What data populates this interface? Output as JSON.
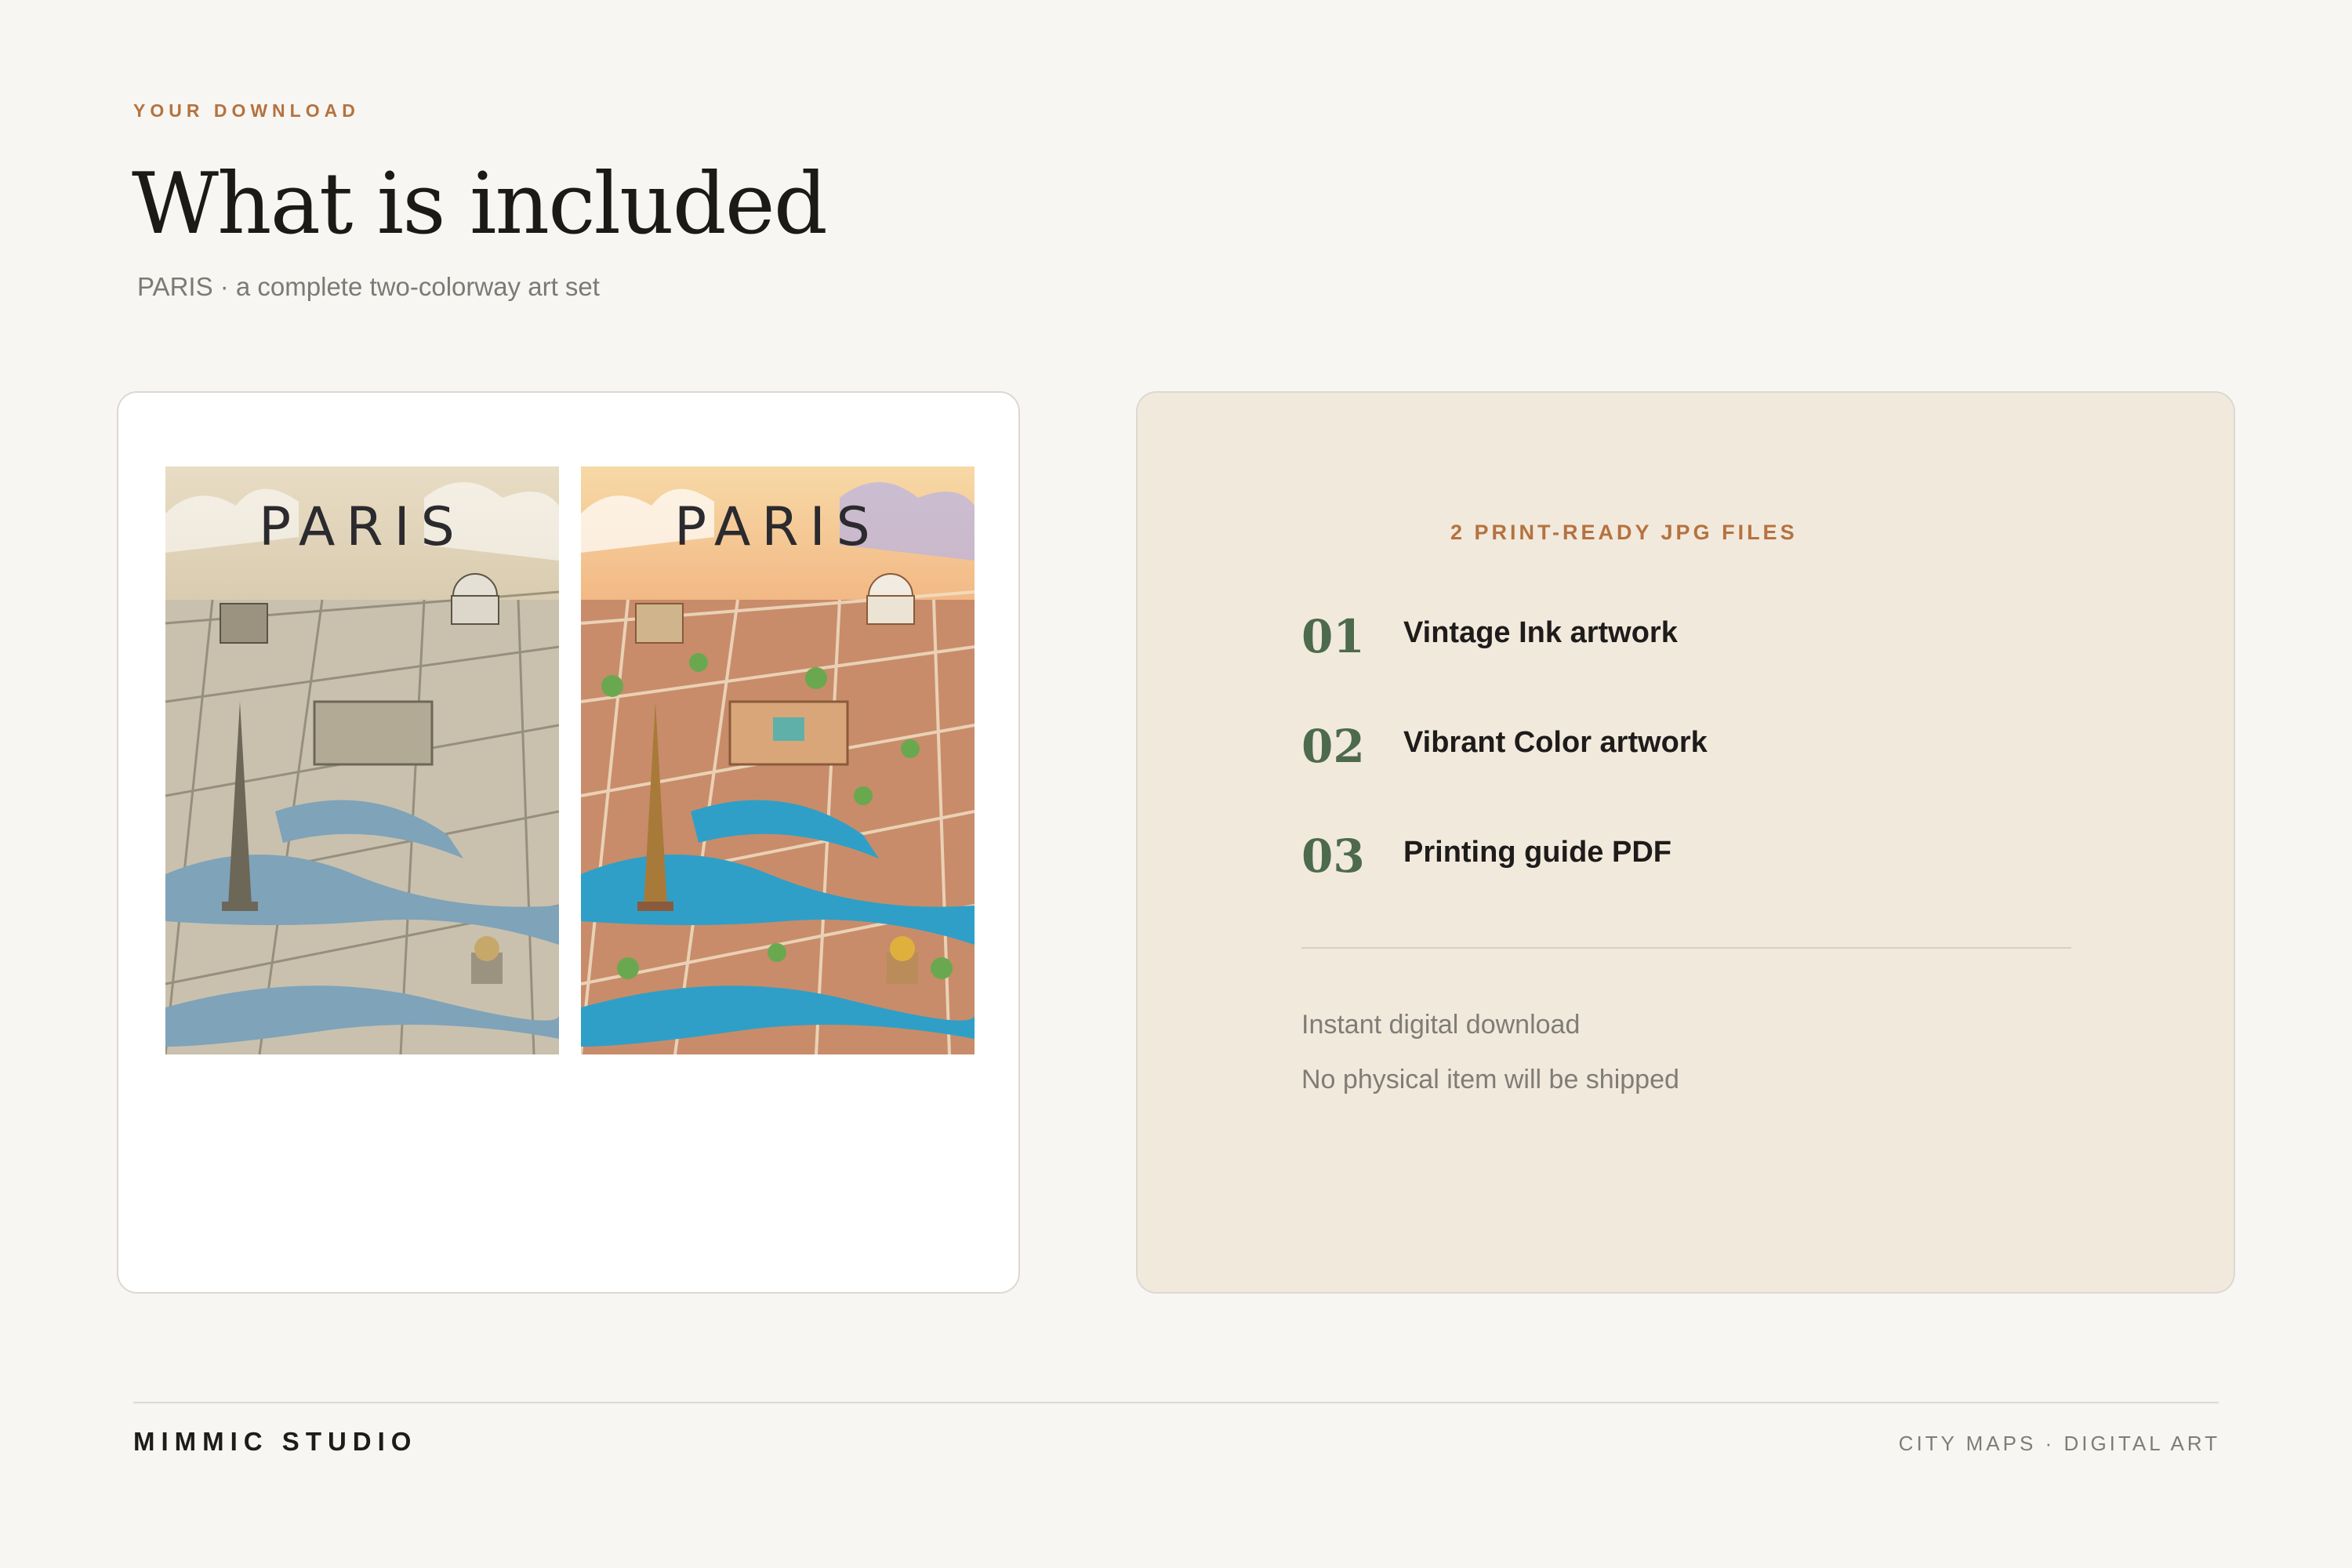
{
  "header": {
    "eyebrow": "YOUR DOWNLOAD",
    "title": "What is included",
    "subtitle": "PARIS · a complete two-colorway art set"
  },
  "previews": [
    {
      "title": "PARIS",
      "icon": "vintage-ink-map-image",
      "palette": {
        "sky": "#efe2c6",
        "ground": "#c9c1ae",
        "water": "#7fa3b9",
        "accent": "#6d6758"
      }
    },
    {
      "title": "PARIS",
      "icon": "vibrant-color-map-image",
      "palette": {
        "sky": "#f6c98f",
        "ground": "#c88c6a",
        "water": "#2f9fc7",
        "accent": "#6aa84f"
      }
    }
  ],
  "files": {
    "heading": "2 PRINT-READY JPG FILES",
    "items": [
      {
        "num": "01",
        "label": "Vintage Ink artwork"
      },
      {
        "num": "02",
        "label": "Vibrant Color artwork"
      },
      {
        "num": "03",
        "label": "Printing guide PDF"
      }
    ],
    "notes": [
      "Instant digital download",
      "No physical item will be shipped"
    ]
  },
  "footer": {
    "brand": "MIMMIC STUDIO",
    "tagline": "CITY MAPS · DIGITAL ART"
  },
  "colors": {
    "accent": "#b5723f",
    "number": "#4d6a4d",
    "panel": "#f2e9dd"
  }
}
